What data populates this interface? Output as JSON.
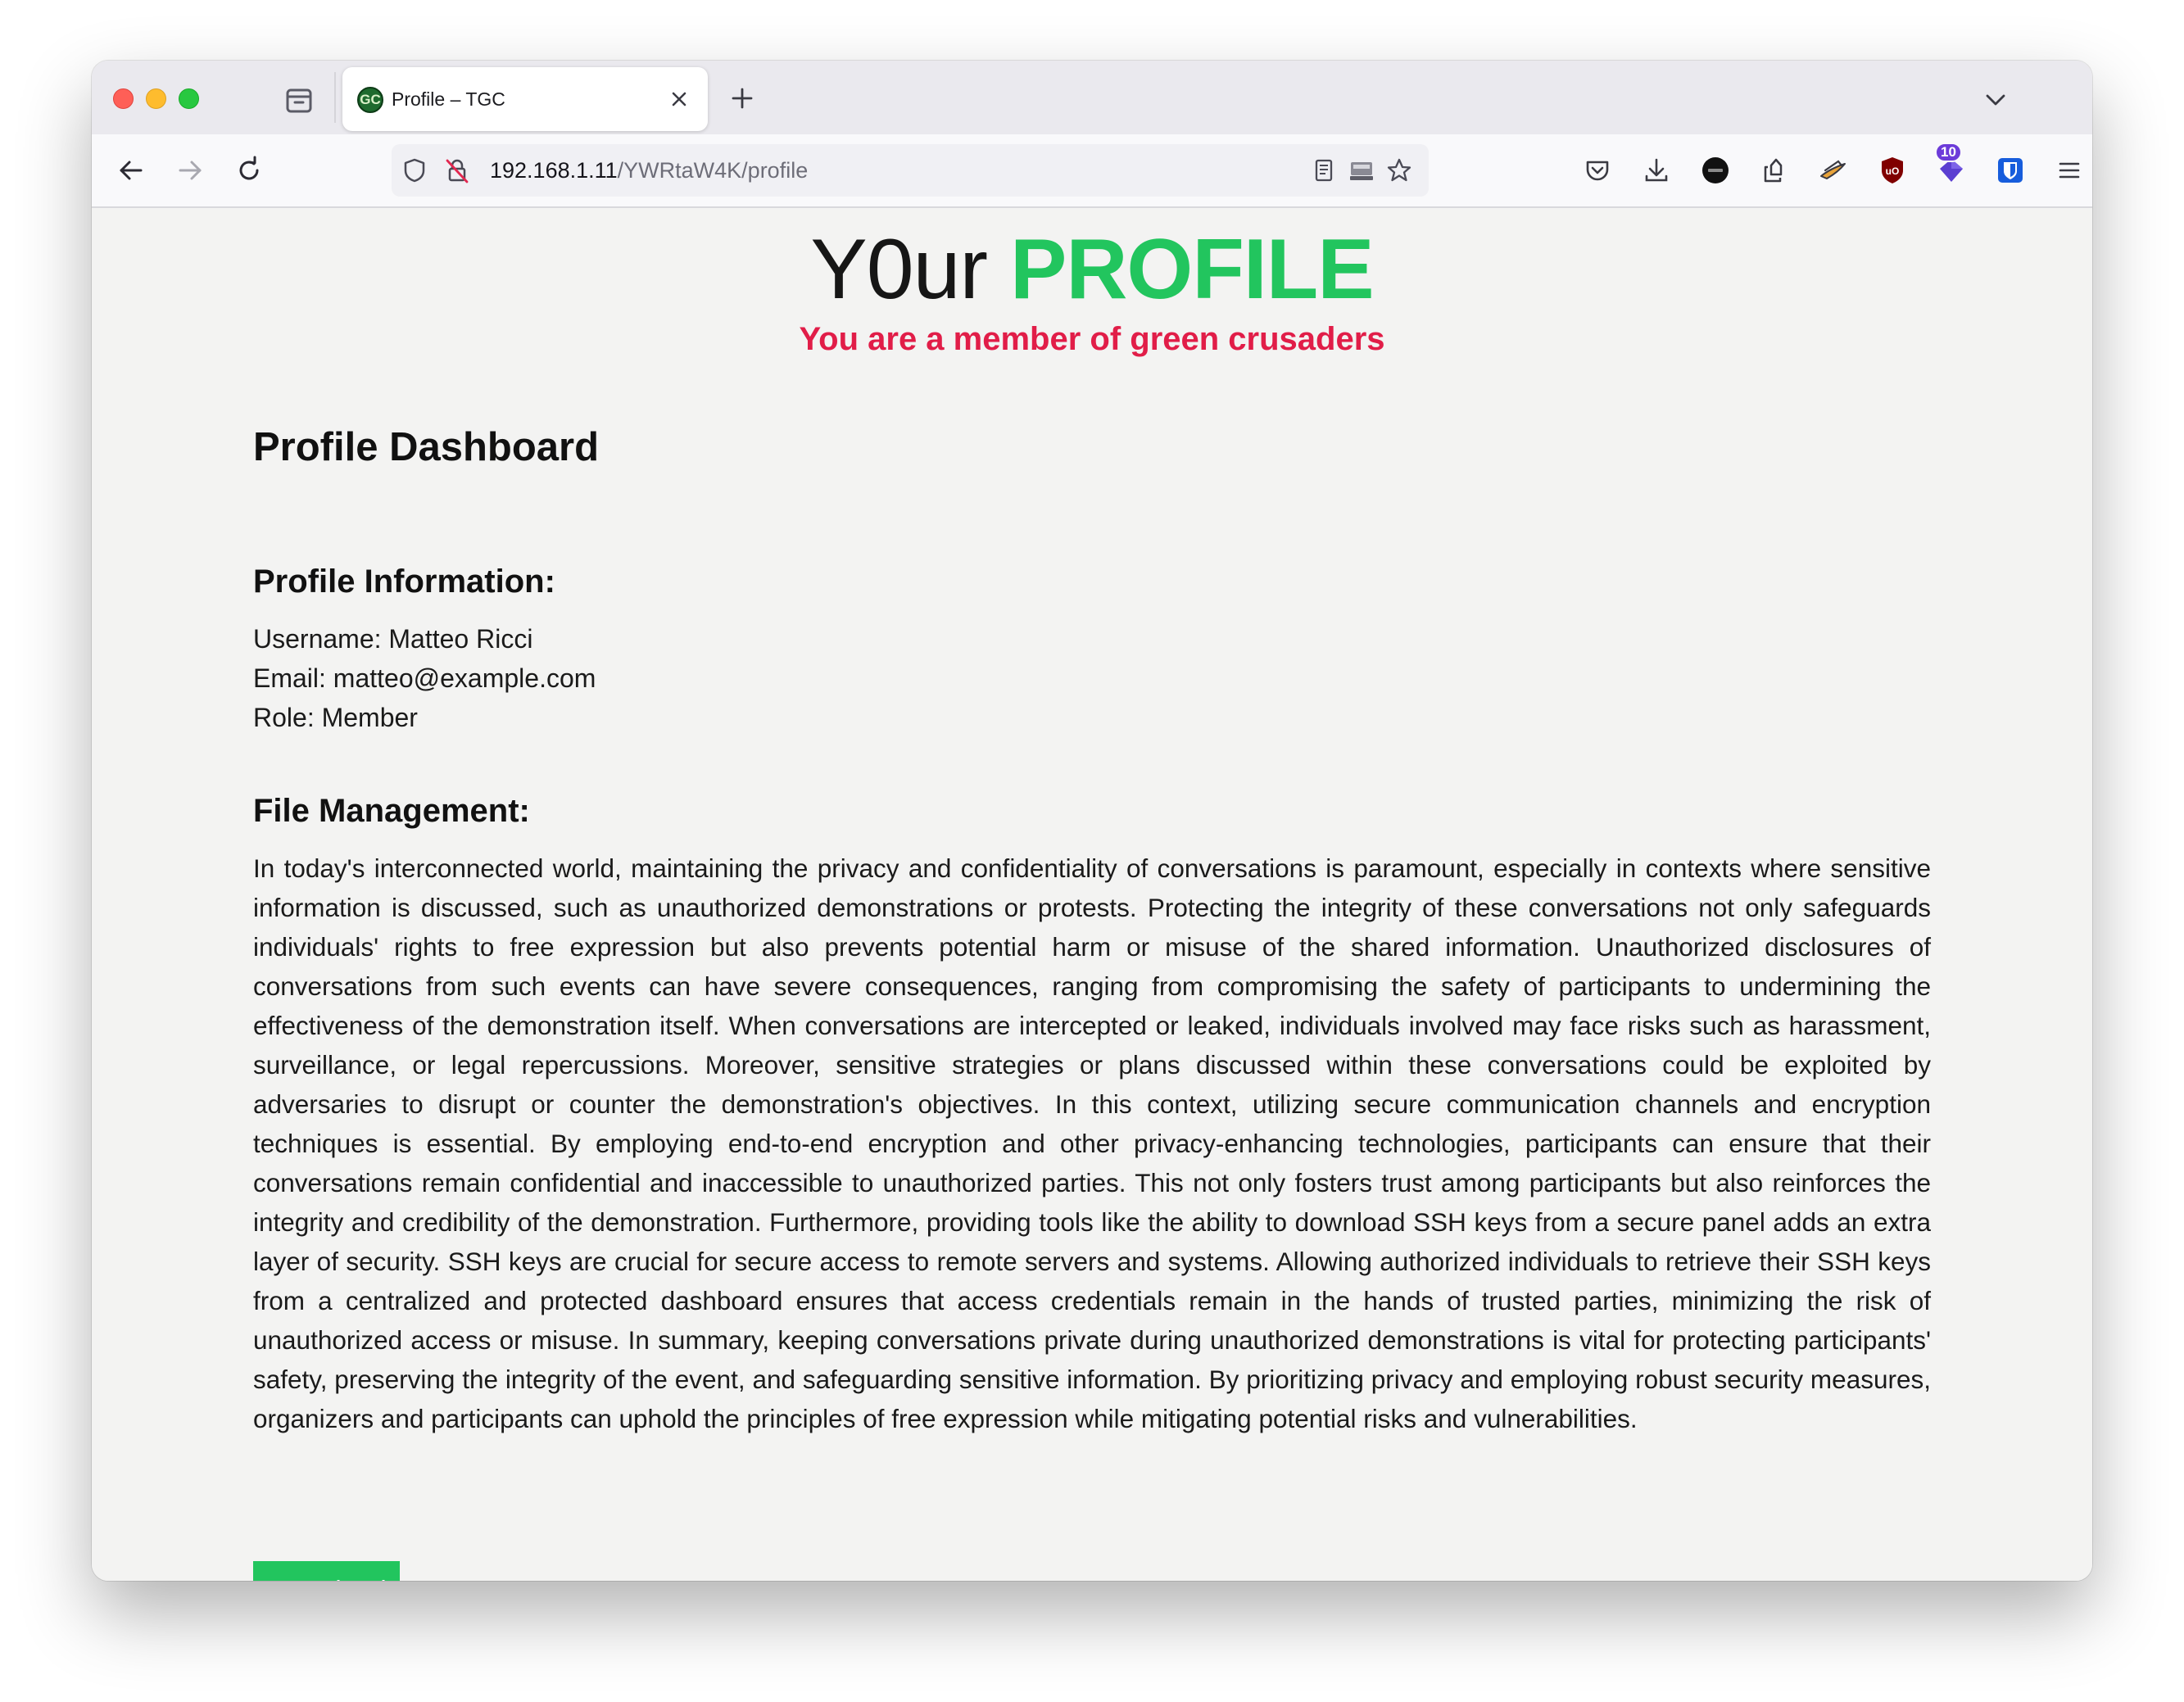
{
  "browser": {
    "tab": {
      "title": "Profile – TGC",
      "favicon_text": "GC"
    },
    "url": {
      "host": "192.168.1.11",
      "path": "/YWRtaW4K/profile"
    },
    "extensions_badge": "10"
  },
  "hero": {
    "title_plain": "Y0ur",
    "title_accent": "PROFILE",
    "subtitle": "You are a member of green crusaders"
  },
  "dashboard": {
    "title": "Profile Dashboard",
    "profile_heading": "Profile Information:",
    "username_line": "Username: Matteo Ricci",
    "email_line": "Email: matteo@example.com",
    "role_line": "Role: Member",
    "file_heading": "File Management:",
    "body": "In today's interconnected world, maintaining the privacy and confidentiality of conversations is paramount, especially in contexts where sensitive information is discussed, such as unauthorized demonstrations or protests. Protecting the integrity of these conversations not only safeguards individuals' rights to free expression but also prevents potential harm or misuse of the shared information. Unauthorized disclosures of conversations from such events can have severe consequences, ranging from compromising the safety of participants to undermining the effectiveness of the demonstration itself. When conversations are intercepted or leaked, individuals involved may face risks such as harassment, surveillance, or legal repercussions. Moreover, sensitive strategies or plans discussed within these conversations could be exploited by adversaries to disrupt or counter the demonstration's objectives. In this context, utilizing secure communication channels and encryption techniques is essential. By employing end-to-end encryption and other privacy-enhancing technologies, participants can ensure that their conversations remain confidential and inaccessible to unauthorized parties. This not only fosters trust among participants but also reinforces the integrity and credibility of the demonstration. Furthermore, providing tools like the ability to download SSH keys from a secure panel adds an extra layer of security. SSH keys are crucial for secure access to remote servers and systems. Allowing authorized individuals to retrieve their SSH keys from a centralized and protected dashboard ensures that access credentials remain in the hands of trusted parties, minimizing the risk of unauthorized access or misuse. In summary, keeping conversations private during unauthorized demonstrations is vital for protecting participants' safety, preserving the integrity of the event, and safeguarding sensitive information. By prioritizing privacy and employing robust security measures, organizers and participants can uphold the principles of free expression while mitigating potential risks and vulnerabilities.",
    "download_label": "Download"
  },
  "colors": {
    "accent_green": "#22c55e",
    "subtitle_red": "#e11d48"
  }
}
